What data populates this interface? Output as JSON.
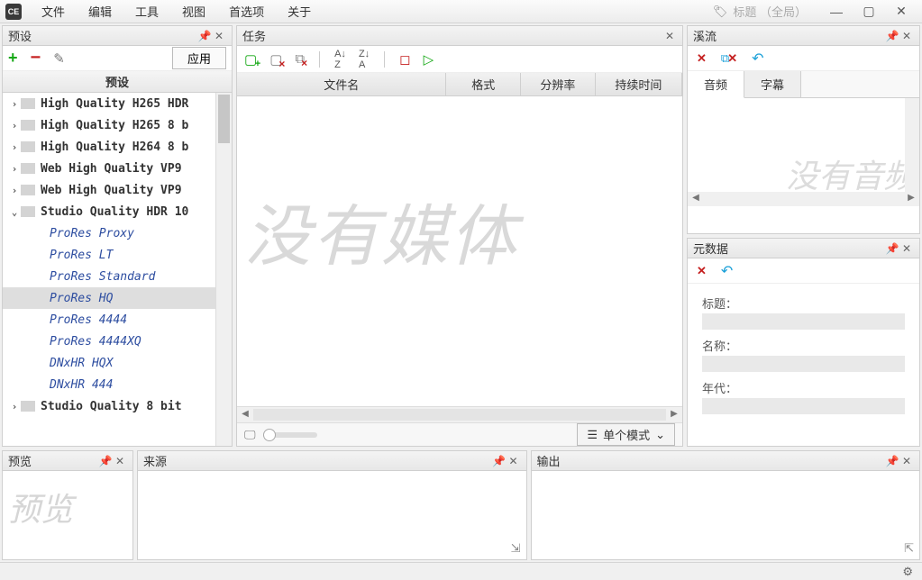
{
  "menu": {
    "logo": "CE",
    "items": [
      "文件",
      "编辑",
      "工具",
      "视图",
      "首选项",
      "关于"
    ],
    "search_hint": "标题 （全局）"
  },
  "panels": {
    "presets": {
      "title": "预设",
      "head": "预设",
      "apply": "应用",
      "tree": [
        {
          "type": "top",
          "expanded": false,
          "label": "High Quality H265 HDR"
        },
        {
          "type": "top",
          "expanded": false,
          "label": "High Quality H265 8 b"
        },
        {
          "type": "top",
          "expanded": false,
          "label": "High Quality H264 8 b"
        },
        {
          "type": "top",
          "expanded": false,
          "label": "Web High Quality VP9"
        },
        {
          "type": "top",
          "expanded": false,
          "label": "Web High Quality VP9"
        },
        {
          "type": "top",
          "expanded": true,
          "label": "Studio Quality HDR 10"
        },
        {
          "type": "child",
          "label": "ProRes Proxy"
        },
        {
          "type": "child",
          "label": "ProRes LT"
        },
        {
          "type": "child",
          "label": "ProRes Standard"
        },
        {
          "type": "child",
          "label": "ProRes HQ",
          "selected": true
        },
        {
          "type": "child",
          "label": "ProRes 4444"
        },
        {
          "type": "child",
          "label": "ProRes 4444XQ"
        },
        {
          "type": "child",
          "label": "DNxHR HQX"
        },
        {
          "type": "child",
          "label": "DNxHR 444"
        },
        {
          "type": "top",
          "expanded": false,
          "label": "Studio Quality 8 bit"
        }
      ]
    },
    "tasks": {
      "title": "任务",
      "columns": [
        "文件名",
        "格式",
        "分辨率",
        "持续时间"
      ],
      "watermark": "没有媒体",
      "mode": "单个模式"
    },
    "streams": {
      "title": "溪流",
      "tabs": [
        "音频",
        "字幕"
      ],
      "active_tab": 0,
      "watermark": "没有音频"
    },
    "metadata": {
      "title": "元数据",
      "fields": [
        "标题：",
        "名称：",
        "年代："
      ]
    },
    "preview": {
      "title": "预览",
      "placeholder": "预览"
    },
    "source": {
      "title": "来源"
    },
    "output": {
      "title": "输出"
    }
  }
}
